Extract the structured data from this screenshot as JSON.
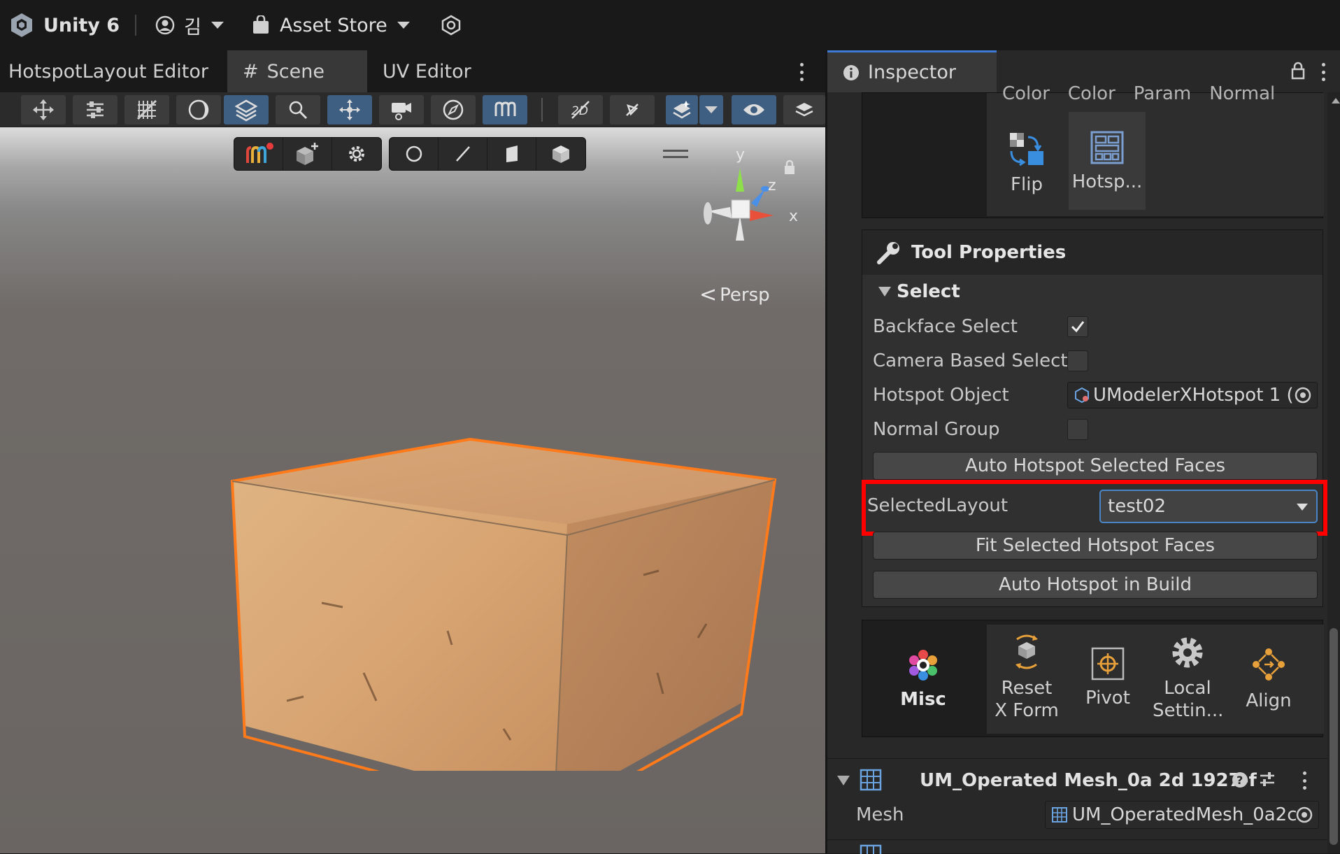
{
  "topbar": {
    "unity_label": "Unity 6",
    "account_label": "김",
    "asset_store_label": "Asset Store"
  },
  "tabs": {
    "hotspot_editor": "HotspotLayout Editor",
    "scene": "Scene",
    "uv_editor": "UV Editor"
  },
  "scene": {
    "persp_label": "Persp",
    "axis_x": "x",
    "axis_y": "y",
    "axis_z": "z"
  },
  "inspector": {
    "title": "Inspector",
    "header_cut_labels": [
      "Color",
      "Color",
      "Param",
      "Normal"
    ],
    "tools_row": [
      {
        "label": "Flip",
        "icon": "flip-icon"
      },
      {
        "label": "Hotsp...",
        "icon": "hotspot-grid-icon"
      }
    ],
    "tool_properties": {
      "title": "Tool Properties",
      "section": "Select",
      "backface_select": "Backface Select",
      "backface_checked": true,
      "camera_based_select": "Camera Based Select",
      "camera_checked": false,
      "hotspot_object": "Hotspot Object",
      "hotspot_object_value": "UModelerXHotspot 1 (",
      "normal_group": "Normal Group",
      "normal_checked": false,
      "auto_hotspot_button": "Auto Hotspot Selected Faces",
      "selected_layout_label": "SelectedLayout",
      "selected_layout_value": "test02",
      "fit_button": "Fit Selected Hotspot Faces",
      "auto_build_button": "Auto Hotspot in Build"
    },
    "misc": {
      "title": "Misc",
      "tools": [
        {
          "label1": "Reset",
          "label2": "X Form",
          "icon": "reset-xform-icon"
        },
        {
          "label1": "Pivot",
          "label2": "",
          "icon": "pivot-icon"
        },
        {
          "label1": "Local",
          "label2": "Settin...",
          "icon": "gear-icon"
        },
        {
          "label1": "Align",
          "label2": "",
          "icon": "align-icon"
        }
      ]
    },
    "component": {
      "title": "UM_Operated Mesh_0a 2d 1927-f",
      "mesh_label": "Mesh",
      "mesh_value": "UM_OperatedMesh_0a2c"
    }
  },
  "colors": {
    "highlight_red": "#ff0000",
    "accent_blue": "#3e5e82",
    "selection_orange": "#ff7a1a"
  }
}
